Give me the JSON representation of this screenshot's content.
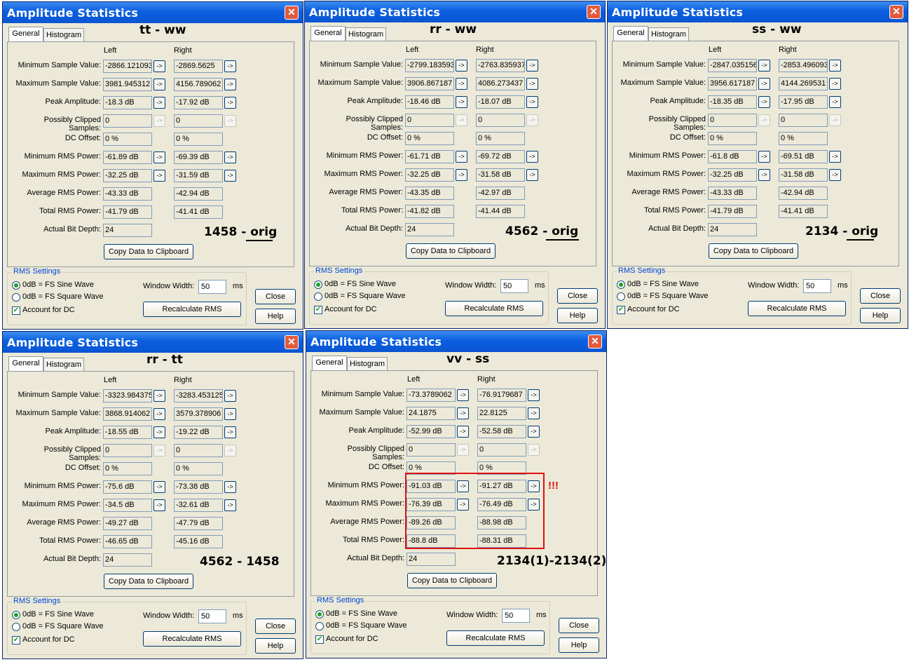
{
  "common": {
    "win_title": "Amplitude Statistics",
    "close_x": "✕",
    "tab_general": "General",
    "tab_histogram": "Histogram",
    "col_left": "Left",
    "col_right": "Right",
    "row_labels": [
      "Minimum Sample Value:",
      "Maximum Sample Value:",
      "Peak Amplitude:",
      "Possibly Clipped Samples:",
      "DC Offset:",
      "Minimum RMS Power:",
      "Maximum RMS Power:",
      "Average RMS Power:",
      "Total RMS Power:",
      "Actual Bit Depth:"
    ],
    "arrow": "->",
    "copy_button": "Copy Data to Clipboard",
    "rms_settings_title": "RMS Settings",
    "radio_sine": "0dB = FS Sine Wave",
    "radio_square": "0dB = FS Square Wave",
    "check_dc": "Account for DC",
    "window_width_label": "Window Width:",
    "window_width_value": "50",
    "window_width_unit": "ms",
    "recalc_button": "Recalculate RMS",
    "close_button": "Close",
    "help_button": "Help"
  },
  "windows": [
    {
      "header_note": "tt - ww",
      "footer_note": "1458 - orig",
      "left": [
        "-2866.121093",
        "3981.945312",
        "-18.3 dB",
        "0",
        "0 %",
        "-61.89 dB",
        "-32.25 dB",
        "-43.33 dB",
        "-41.79 dB",
        "24"
      ],
      "right": [
        "-2869.5625",
        "4156.789062",
        "-17.92 dB",
        "0",
        "0 %",
        "-69.39 dB",
        "-31.59 dB",
        "-42.94 dB",
        "-41.41 dB"
      ]
    },
    {
      "header_note": "rr - ww",
      "footer_note": "4562 - orig",
      "left": [
        "-2799.183593",
        "3906.867187",
        "-18.46 dB",
        "0",
        "0 %",
        "-61.71 dB",
        "-32.25 dB",
        "-43.35 dB",
        "-41.82 dB",
        "24"
      ],
      "right": [
        "-2763.835937",
        "4086.273437",
        "-18.07 dB",
        "0",
        "0 %",
        "-69.72 dB",
        "-31.58 dB",
        "-42.97 dB",
        "-41.44 dB"
      ]
    },
    {
      "header_note": "ss - ww",
      "footer_note": "2134 - orig",
      "left": [
        "-2847.035156",
        "3956.617187",
        "-18.35 dB",
        "0",
        "0 %",
        "-61.8 dB",
        "-32.25 dB",
        "-43.33 dB",
        "-41.79 dB",
        "24"
      ],
      "right": [
        "-2853.496093",
        "4144.269531",
        "-17.95 dB",
        "0",
        "0 %",
        "-69.51 dB",
        "-31.58 dB",
        "-42.94 dB",
        "-41.41 dB"
      ]
    },
    {
      "header_note": "rr - tt",
      "footer_note": "4562 - 1458",
      "left": [
        "-3323.984375",
        "3868.914062",
        "-18.55 dB",
        "0",
        "0 %",
        "-75.6 dB",
        "-34.5 dB",
        "-49.27 dB",
        "-46.65 dB",
        "24"
      ],
      "right": [
        "-3283.453125",
        "3579.378906",
        "-19.22 dB",
        "0",
        "0 %",
        "-73.38 dB",
        "-32.61 dB",
        "-47.79 dB",
        "-45.16 dB"
      ]
    },
    {
      "header_note": "vv - ss",
      "footer_note": "2134(1)-2134(2)",
      "left": [
        "-73.3789062",
        "24.1875",
        "-52.99 dB",
        "0",
        "0 %",
        "-91.03 dB",
        "-76.39 dB",
        "-89.26 dB",
        "-88.8 dB",
        "24"
      ],
      "right": [
        "-76.9179687",
        "22.8125",
        "-52.58 dB",
        "0",
        "0 %",
        "-91.27 dB",
        "-76.49 dB",
        "-88.98 dB",
        "-88.31 dB"
      ]
    }
  ],
  "highlight_note": "!!!"
}
